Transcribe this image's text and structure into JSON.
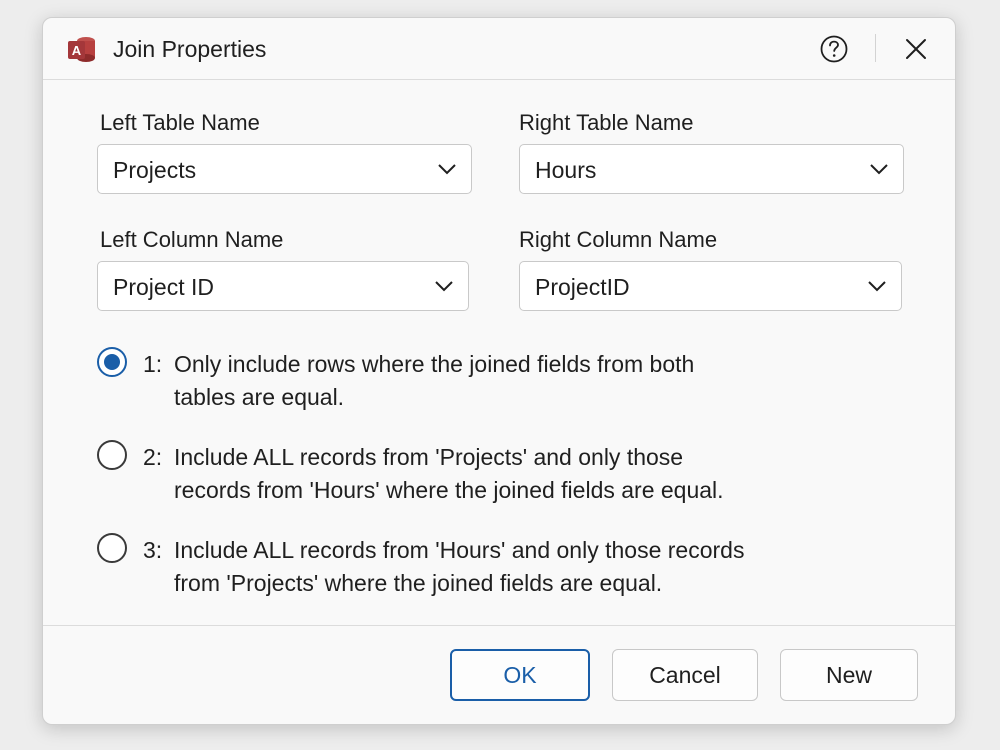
{
  "dialog": {
    "title": "Join Properties",
    "app_icon_letter": "A",
    "help_icon": "help-circle-icon",
    "close_icon": "close-icon"
  },
  "fields": {
    "left_table": {
      "label": "Left Table Name",
      "value": "Projects"
    },
    "right_table": {
      "label": "Right Table Name",
      "value": "Hours"
    },
    "left_column": {
      "label": "Left Column Name",
      "value": "Project ID"
    },
    "right_column": {
      "label": "Right Column Name",
      "value": "ProjectID"
    }
  },
  "join_options": [
    {
      "number": "1:",
      "line1": "Only include rows where the joined fields from both",
      "line2": "tables are equal.",
      "checked": true
    },
    {
      "number": "2:",
      "line1": "Include ALL records from 'Projects' and only those",
      "line2": "records from 'Hours' where the joined fields are equal.",
      "checked": false
    },
    {
      "number": "3:",
      "line1": "Include ALL records from 'Hours' and only those records",
      "line2": "from 'Projects' where the joined fields are equal.",
      "checked": false
    }
  ],
  "buttons": {
    "ok": "OK",
    "cancel": "Cancel",
    "new": "New"
  },
  "colors": {
    "accent": "#1a5ea8",
    "access_red": "#a4373a"
  }
}
